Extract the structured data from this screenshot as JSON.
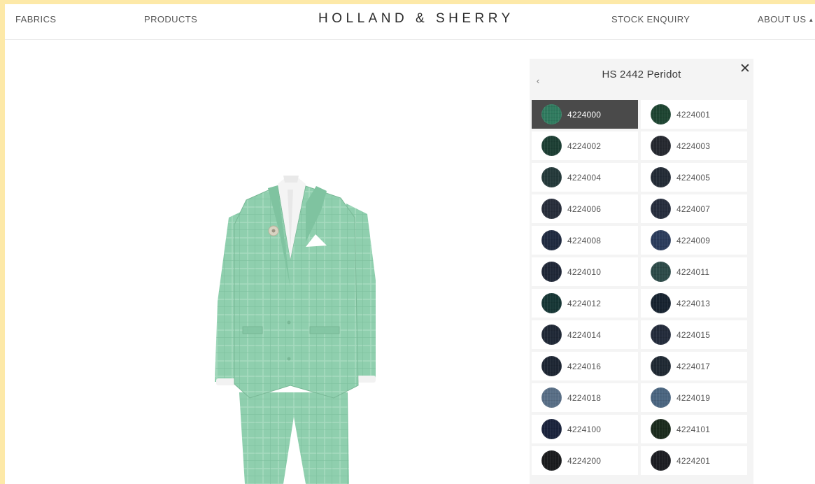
{
  "nav": {
    "fabrics": "FABRICS",
    "products": "PRODUCTS",
    "brand": "HOLLAND & SHERRY",
    "stock_enquiry": "STOCK ENQUIRY",
    "about_us": "ABOUT US",
    "about_caret": "▲"
  },
  "panel": {
    "title": "HS 2442 Peridot",
    "back_glyph": "‹",
    "close_glyph": "✕",
    "selected_code": "4224000",
    "swatches": [
      {
        "code": "4224000",
        "color": "#2f7a5e"
      },
      {
        "code": "4224001",
        "color": "#1d4431"
      },
      {
        "code": "4224002",
        "color": "#1c3e33"
      },
      {
        "code": "4224003",
        "color": "#25282f"
      },
      {
        "code": "4224004",
        "color": "#24393a"
      },
      {
        "code": "4224005",
        "color": "#232b36"
      },
      {
        "code": "4224006",
        "color": "#272d3a"
      },
      {
        "code": "4224007",
        "color": "#262d3d"
      },
      {
        "code": "4224008",
        "color": "#1f2a40"
      },
      {
        "code": "4224009",
        "color": "#2b3c5c"
      },
      {
        "code": "4224010",
        "color": "#1f2737"
      },
      {
        "code": "4224011",
        "color": "#2c4a48"
      },
      {
        "code": "4224012",
        "color": "#163635"
      },
      {
        "code": "4224013",
        "color": "#172330"
      },
      {
        "code": "4224014",
        "color": "#1f2836"
      },
      {
        "code": "4224015",
        "color": "#232b3b"
      },
      {
        "code": "4224016",
        "color": "#1d2633"
      },
      {
        "code": "4224017",
        "color": "#1f2933"
      },
      {
        "code": "4224018",
        "color": "#586e86"
      },
      {
        "code": "4224019",
        "color": "#4a6580"
      },
      {
        "code": "4224100",
        "color": "#1a233c"
      },
      {
        "code": "4224101",
        "color": "#1b2b1d"
      },
      {
        "code": "4224200",
        "color": "#1a1b1d"
      },
      {
        "code": "4224201",
        "color": "#1c1d22"
      }
    ]
  },
  "colors": {
    "page_bg": "#fde9a8",
    "suit": "#8fcfae",
    "selected_bg": "#4a4a4a"
  }
}
